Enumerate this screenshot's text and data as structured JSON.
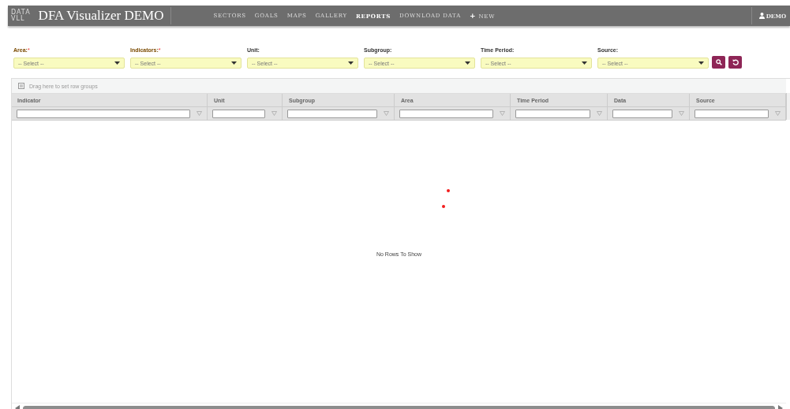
{
  "brand": {
    "logo_top": "DATA",
    "logo_bottom": "VLL",
    "title": "DFA Visualizer DEMO"
  },
  "nav": [
    {
      "label": "SECTORS",
      "selected": false
    },
    {
      "label": "GOALS",
      "selected": false
    },
    {
      "label": "MAPS",
      "selected": false
    },
    {
      "label": "GALLERY",
      "selected": false
    },
    {
      "label": "REPORTS",
      "selected": true
    },
    {
      "label": "DOWNLOAD DATA",
      "selected": false
    }
  ],
  "new_button": {
    "icon": "+",
    "label": "NEW"
  },
  "user": "DEMO",
  "filters": [
    {
      "label": "Area:",
      "required_mark": "*",
      "placeholder": "-- Select --"
    },
    {
      "label": "Indicators:",
      "required_mark": "*",
      "placeholder": "-- Select --"
    },
    {
      "label": "Unit:",
      "placeholder": "-- Select --"
    },
    {
      "label": "Subgroup:",
      "placeholder": "-- Select --"
    },
    {
      "label": "Time Period:",
      "placeholder": "-- Select --"
    },
    {
      "label": "Source:",
      "placeholder": "-- Select --"
    }
  ],
  "grid": {
    "group_hint": "Drag here to set row groups",
    "columns": [
      "Indicator",
      "Unit",
      "Subgroup",
      "Area",
      "Time Period",
      "Data",
      "Source"
    ],
    "empty_message": "No Rows To Show"
  }
}
